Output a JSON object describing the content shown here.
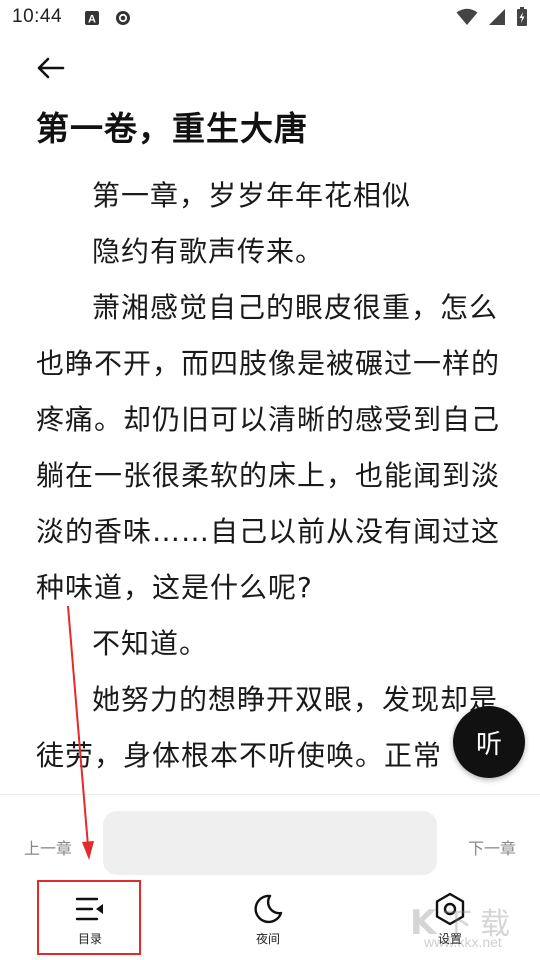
{
  "status_bar": {
    "time": "10:44",
    "left_icons": [
      "a-app-icon",
      "sync-app-icon"
    ],
    "right_icons": [
      "wifi-icon",
      "signal-icon",
      "battery-icon"
    ]
  },
  "header": {
    "back_icon": "arrow-left-icon"
  },
  "volume_title": "第一卷，重生大唐",
  "content": {
    "paragraphs": [
      "第一章，岁岁年年花相似",
      "隐约有歌声传来。",
      "萧湘感觉自己的眼皮很重，怎么也睁不开，而四肢像是被碾过一样的疼痛。却仍旧可以清晰的感受到自己躺在一张很柔软的床上，也能闻到淡淡的香味……自己以前从没有闻过这种味道，这是什么呢?",
      "不知道。",
      "她努力的想睁开双眼，发现却是徒劳，身体根本不听使唤。正常"
    ]
  },
  "listen_button": {
    "label": "听"
  },
  "chapter_nav": {
    "prev_label": "上一章",
    "next_label": "下一章"
  },
  "bottom_bar": {
    "tabs": [
      {
        "label": "目录",
        "icon": "table-of-contents-icon"
      },
      {
        "label": "夜间",
        "icon": "moon-icon"
      },
      {
        "label": "设置",
        "icon": "settings-hexagon-icon"
      }
    ]
  },
  "annotation": {
    "color": "#e32b2b"
  },
  "watermark": {
    "text": "www.kkx.net",
    "logo": "kkx-watermark-logo"
  }
}
